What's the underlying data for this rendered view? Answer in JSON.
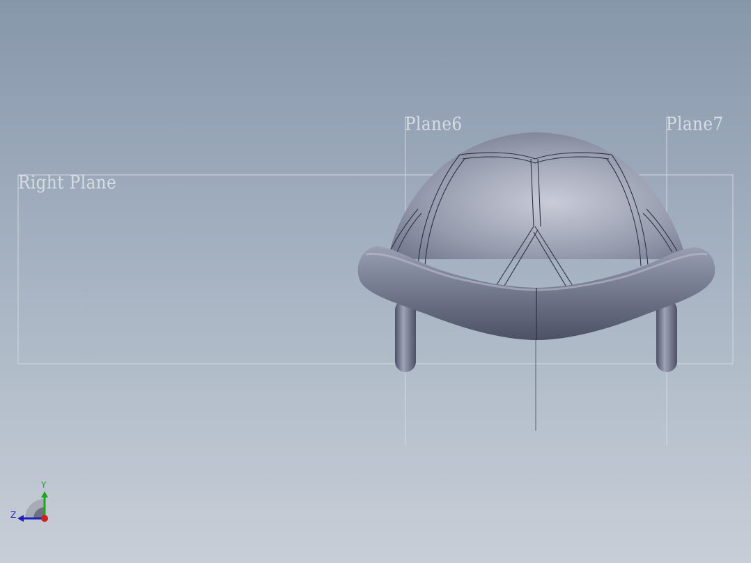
{
  "viewport": {
    "planes": {
      "right_plane": "Right Plane",
      "plane6": "Plane6",
      "plane7": "Plane7"
    },
    "triad": {
      "y_label": "Y",
      "z_label": "Z",
      "y_color": "#1fa51f",
      "z_color": "#1f1fbf",
      "x_color": "#d01f1f"
    },
    "model_color": "#7a8196",
    "background_top": "#8797aa",
    "background_bottom": "#c8ced7"
  }
}
